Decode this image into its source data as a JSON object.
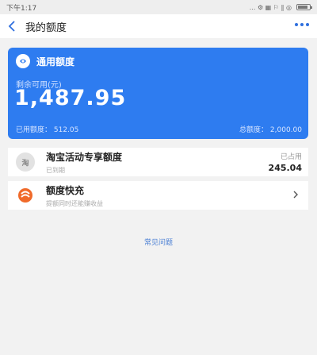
{
  "status_bar": {
    "time": "下午1:17",
    "indicators": "... ⚙ ▦ ⚐ ∥ ◎"
  },
  "nav": {
    "back_icon": "chevron-left-icon",
    "title": "我的额度",
    "more_icon": "more-dots-icon"
  },
  "card": {
    "title": "通用额度",
    "available_label": "剩余可用(元)",
    "available_amount": "1,487.95",
    "used_label": "已用额度：",
    "used_value": "512.05",
    "total_label": "总额度：",
    "total_value": "2,000.00",
    "color": "#2e7cf0"
  },
  "rows": [
    {
      "icon": "taobao-icon",
      "icon_text": "淘",
      "title": "淘宝活动专享额度",
      "subtitle": "已到期",
      "right_label": "已占用",
      "right_value": "245.04"
    },
    {
      "icon": "quick-charge-icon",
      "title": "额度快充",
      "subtitle": "提额同时还能赚收益"
    }
  ],
  "faq": {
    "label": "常见问题",
    "color": "#4a7fd4"
  }
}
